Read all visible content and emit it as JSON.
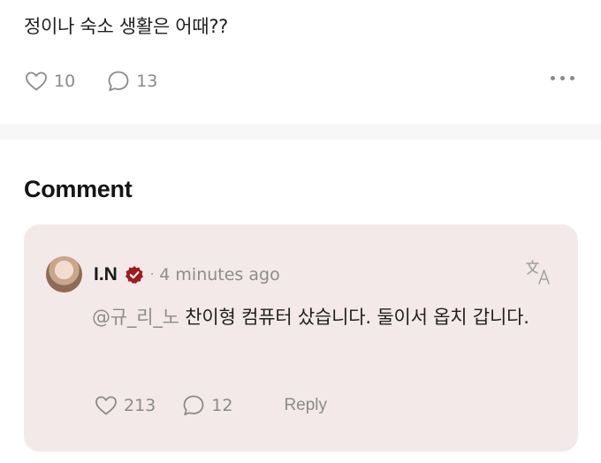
{
  "post": {
    "text": "정이나 숙소 생활은 어때??",
    "likes": "10",
    "comments": "13"
  },
  "section_title": "Comment",
  "comment": {
    "author": "I.N",
    "separator": "·",
    "time": "4 minutes ago",
    "mention": "@규_리_노",
    "body": " 찬이형 컴퓨터 샀습니다. 둘이서 옵치 갑니다.",
    "likes": "213",
    "replies": "12",
    "reply_label": "Reply"
  },
  "colors": {
    "card_background": "#f3e9e9",
    "verified_badge": "#a0191d",
    "muted_text": "#8a8a8a"
  },
  "icons": {
    "like": "heart-outline-icon",
    "comment": "speech-bubble-icon",
    "more": "more-dots-icon",
    "verified": "verified-badge-icon",
    "translate": "translate-icon"
  }
}
